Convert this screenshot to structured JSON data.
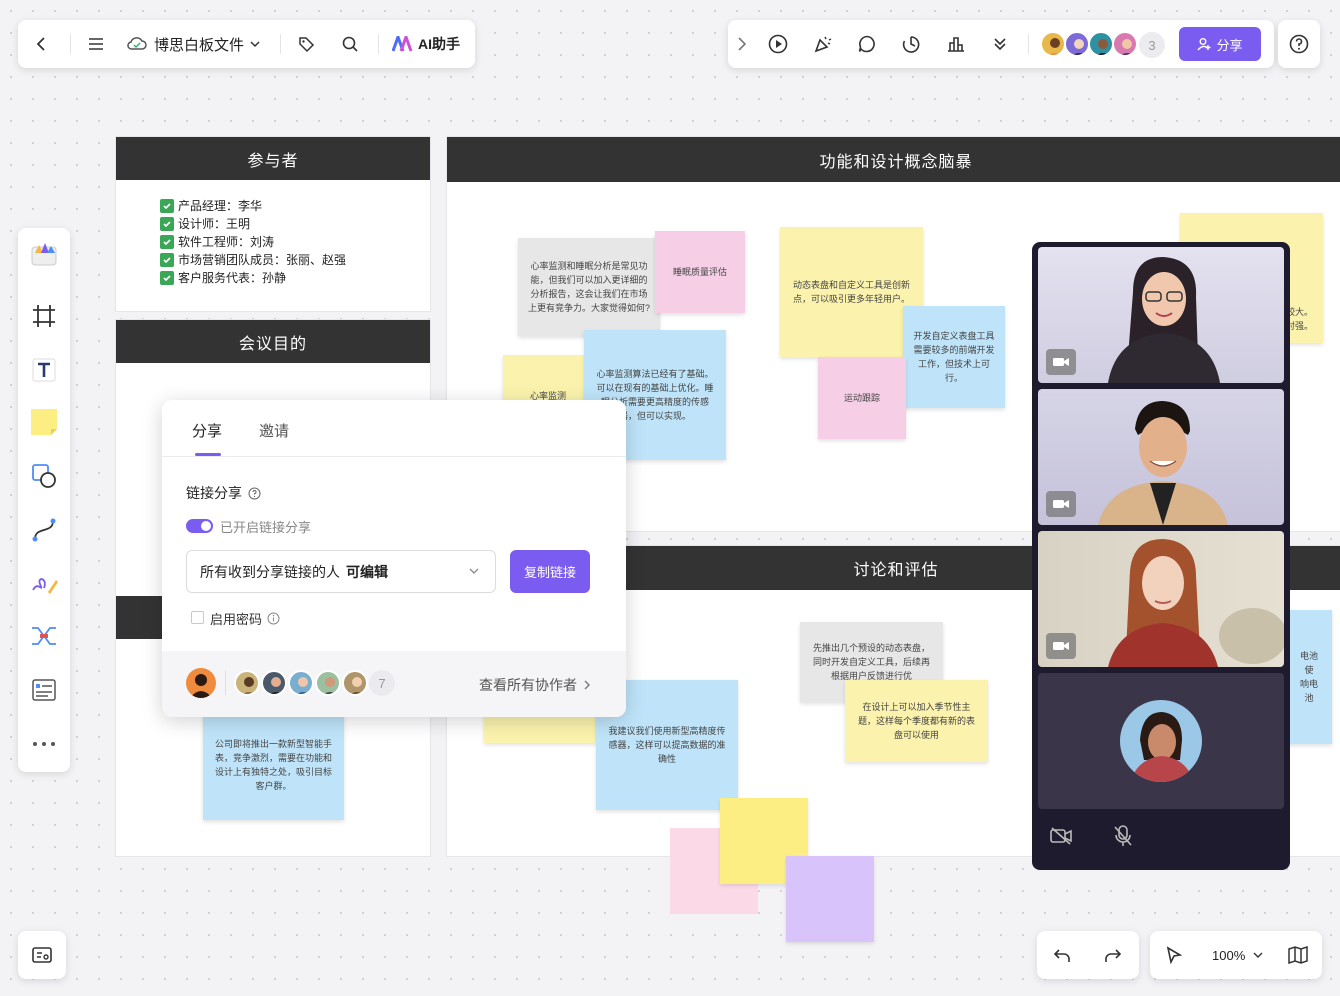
{
  "toolbar_left": {
    "doc_title": "博思白板文件",
    "ai_label": "AI助手"
  },
  "toolbar_right": {
    "collaborator_count": "3",
    "share_label": "分享"
  },
  "frames": {
    "participants": {
      "title": "参与者",
      "items": [
        "产品经理：李华",
        "设计师：王明",
        "软件工程师：刘涛",
        "市场营销团队成员：张丽、赵强",
        "客户服务代表：孙静"
      ]
    },
    "purpose": {
      "title": "会议目的"
    },
    "brainstorm": {
      "title": "功能和设计概念脑暴"
    },
    "discussion": {
      "title": "讨论和评估"
    }
  },
  "notes": {
    "n1": "心率监测和睡眠分析是常见功能，但我们可以加入更详细的分析报告，这会让我们在市场上更有竞争力。大家觉得如何?",
    "n2": "睡眠质量评估",
    "n3": "心率监测",
    "n4": "心率监测算法已经有了基础。可以在现有的基础上优化。睡眠分析需要更高精度的传感器，但可以实现。",
    "n5": "动态表盘和自定义工具是创新点，可以吸引更多年轻用户。",
    "n6": "开发自定义表盘工具需要较多的前端开发工作，但技术上可行。",
    "n7": "运动跟踪",
    "n8a": "本较大。",
    "n8b": "相对强。",
    "n9": "先推出几个预设的动态表盘，同时开发自定义工具，后续再根据用户反馈进行优",
    "n10": "在设计上可以加入季节性主题，这样每个季度都有新的表盘可以使用",
    "n11": "我建议我们使用新型高精度传感器，这样可以提高数据的准确性",
    "n12": "公司即将推出一款新型智能手表，竞争激烈，需要在功能和设计上有独特之处，吸引目标客户群。",
    "n13a": "电池使",
    "n13b": "响电池"
  },
  "share_dialog": {
    "tab_share": "分享",
    "tab_invite": "邀请",
    "link_share_label": "链接分享",
    "toggle_label": "已开启链接分享",
    "permission_prefix": "所有收到分享链接的人",
    "permission_value": "可编辑",
    "copy_button": "复制链接",
    "password_label": "启用密码",
    "collaborator_count": "7",
    "view_all": "查看所有协作者"
  },
  "zoom": {
    "value": "100%"
  },
  "colors": {
    "accent": "#7b5cf0",
    "frame_header": "#333333",
    "video_panel": "#1e1b2e",
    "note_yellow": "#fbf3ad",
    "note_blue": "#bfe4f9",
    "note_pink": "#f6cfe6",
    "note_gray": "#e7e7e7",
    "note_purple": "#d9c3fb"
  }
}
